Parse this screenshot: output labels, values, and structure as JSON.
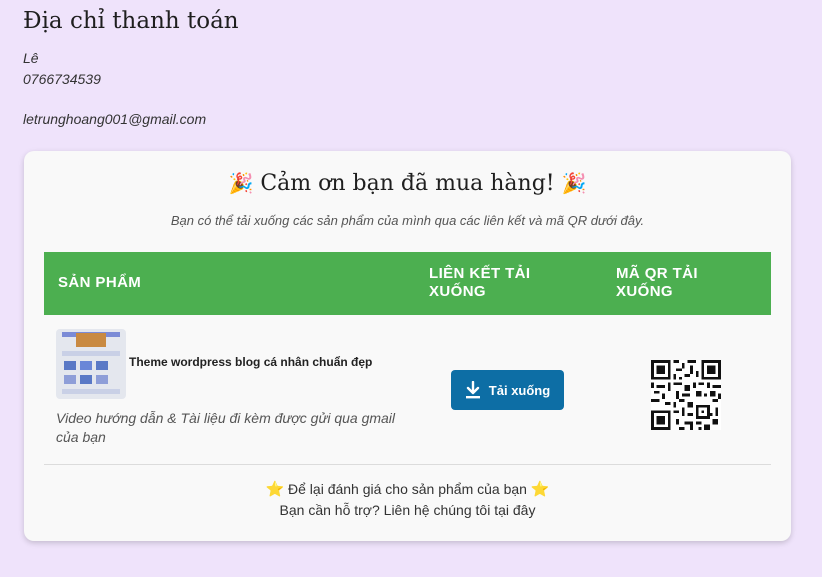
{
  "billing": {
    "title": "Địa chỉ thanh toán",
    "name": "Lê",
    "phone": "0766734539",
    "email": "letrunghoang001@gmail.com"
  },
  "thanks": {
    "message": "Cảm ơn bạn đã mua hàng!",
    "confetti_icon": "🎉",
    "subtitle": "Bạn có thể tải xuống các sản phẩm của mình qua các liên kết và mã QR dưới đây."
  },
  "table": {
    "headers": [
      "SẢN PHẨM",
      "LIÊN KẾT TẢI XUỐNG",
      "MÃ QR TẢI XUỐNG"
    ],
    "header_color": "#4caf50",
    "rows": [
      {
        "product_name": "Theme wordpress blog cá nhân chuẩn đẹp",
        "note": "Video hướng dẫn & Tài liệu đi kèm được gửi qua gmail của bạn",
        "download_label": "Tải xuống",
        "download_icon": "download-icon",
        "qr_icon": "qr-code"
      }
    ]
  },
  "footer": {
    "review_text": "Để lại đánh giá cho sản phẩm của bạn",
    "star_icon": "⭐",
    "support_text": "Bạn cần hỗ trợ? Liên hệ chúng tôi tại đây"
  },
  "colors": {
    "background": "#efe3fb",
    "button": "#0d6ea5",
    "accent_green": "#4caf50"
  }
}
